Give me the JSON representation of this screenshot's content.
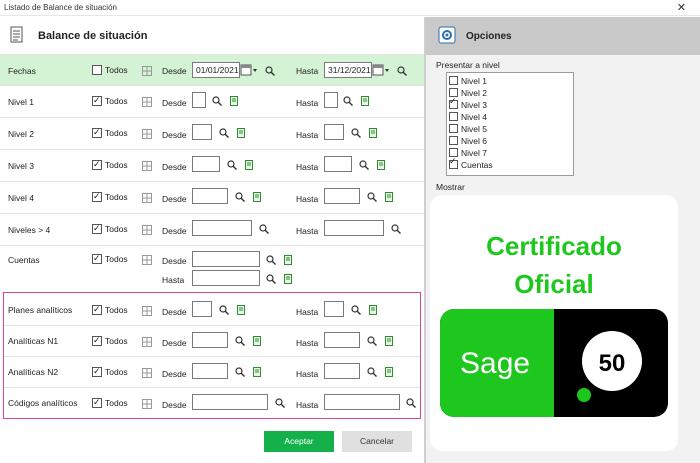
{
  "window": {
    "title": "Listado de Balance de situación",
    "close": "✕"
  },
  "header": {
    "title": "Balance de situación"
  },
  "labels": {
    "todos": "Todos",
    "desde": "Desde",
    "hasta": "Hasta"
  },
  "rows": {
    "fechas": {
      "label": "Fechas",
      "desde": "01/01/2021",
      "hasta": "31/12/2021"
    },
    "nivel1": {
      "label": "Nivel 1"
    },
    "nivel2": {
      "label": "Nivel 2"
    },
    "nivel3": {
      "label": "Nivel 3"
    },
    "nivel4": {
      "label": "Nivel 4"
    },
    "niveles": {
      "label": "Niveles  > 4"
    },
    "cuentas": {
      "label": "Cuentas"
    },
    "planes": {
      "label": "Planes  analíticos"
    },
    "an1": {
      "label": "Analíticas  N1"
    },
    "an2": {
      "label": "Analíticas  N2"
    },
    "codigos": {
      "label": "Códigos analíticos"
    }
  },
  "buttons": {
    "ok": "Aceptar",
    "cancel": "Cancelar"
  },
  "options": {
    "title": "Opciones",
    "presentar": "Presentar a nivel",
    "levels": [
      {
        "label": "Nivel 1",
        "checked": false
      },
      {
        "label": "Nivel 2",
        "checked": false
      },
      {
        "label": "Nivel 3",
        "checked": true
      },
      {
        "label": "Nivel 4",
        "checked": false
      },
      {
        "label": "Nivel 5",
        "checked": false
      },
      {
        "label": "Nivel 6",
        "checked": false
      },
      {
        "label": "Nivel 7",
        "checked": false
      },
      {
        "label": "Cuentas",
        "checked": true
      }
    ],
    "mostrar": "Mostrar"
  },
  "certificate": {
    "line1": "Certificado",
    "line2": "Oficial",
    "brand": "Sage",
    "number": "50"
  },
  "colors": {
    "green": "#14b04a",
    "cert_green": "#1ec71e",
    "fechas_bg": "#d4f2d4",
    "analitica_border": "#d9468a"
  }
}
